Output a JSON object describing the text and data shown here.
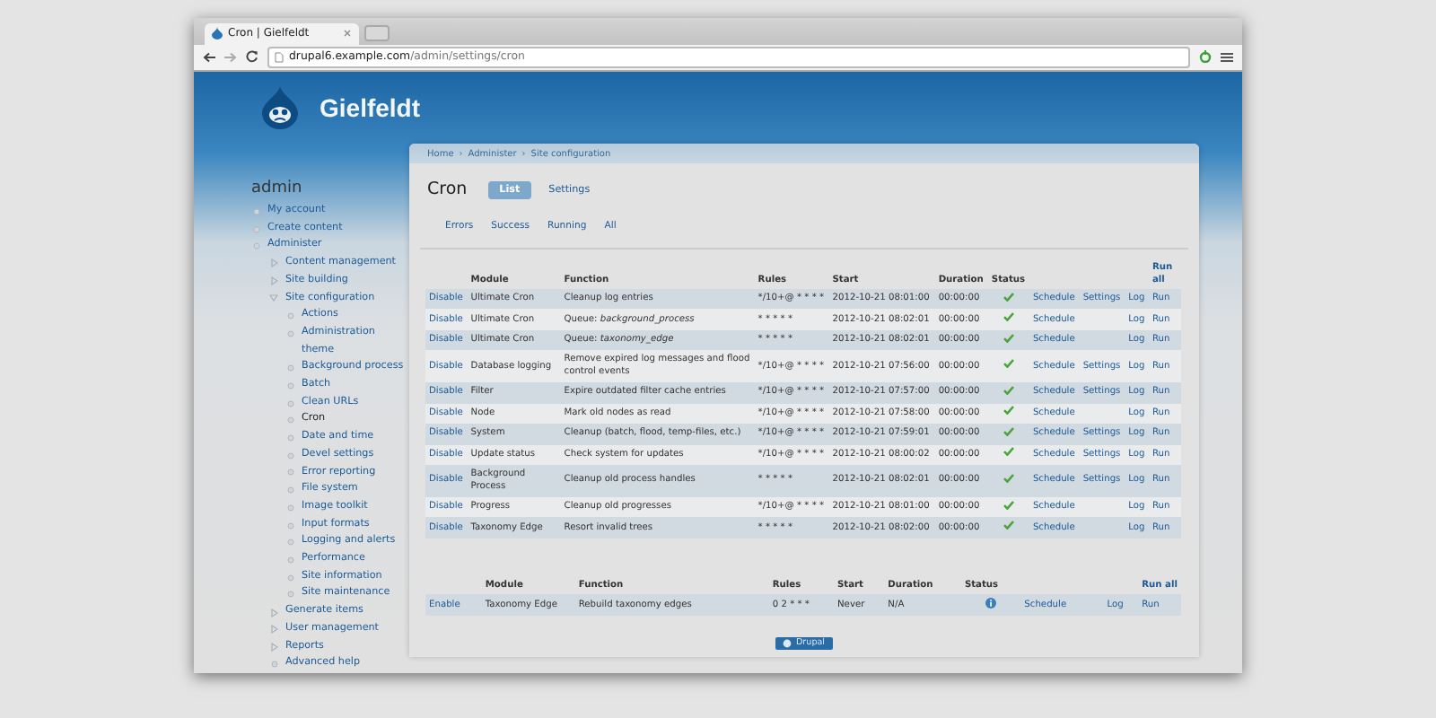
{
  "browser": {
    "tab_title": "Cron | Gielfeldt",
    "url_host": "drupal6.example.com",
    "url_path": "/admin/settings/cron"
  },
  "site": {
    "name": "Gielfeldt"
  },
  "sidebar": {
    "title": "admin",
    "items": [
      {
        "label": "My account",
        "kind": "leaf",
        "selected": false
      },
      {
        "label": "Create content",
        "kind": "leaf",
        "selected": false
      },
      {
        "label": "Administer",
        "kind": "leaf",
        "selected": false,
        "children": [
          {
            "label": "Content management",
            "kind": "collapsed",
            "selected": false
          },
          {
            "label": "Site building",
            "kind": "collapsed",
            "selected": false
          },
          {
            "label": "Site configuration",
            "kind": "expanded",
            "selected": false,
            "children": [
              {
                "label": "Actions",
                "kind": "leaf",
                "selected": false
              },
              {
                "label": "Administration theme",
                "kind": "leaf",
                "selected": false
              },
              {
                "label": "Background process",
                "kind": "leaf",
                "selected": false
              },
              {
                "label": "Batch",
                "kind": "leaf",
                "selected": false
              },
              {
                "label": "Clean URLs",
                "kind": "leaf",
                "selected": false
              },
              {
                "label": "Cron",
                "kind": "leaf",
                "selected": true
              },
              {
                "label": "Date and time",
                "kind": "leaf",
                "selected": false
              },
              {
                "label": "Devel settings",
                "kind": "leaf",
                "selected": false
              },
              {
                "label": "Error reporting",
                "kind": "leaf",
                "selected": false
              },
              {
                "label": "File system",
                "kind": "leaf",
                "selected": false
              },
              {
                "label": "Image toolkit",
                "kind": "leaf",
                "selected": false
              },
              {
                "label": "Input formats",
                "kind": "leaf",
                "selected": false
              },
              {
                "label": "Logging and alerts",
                "kind": "leaf",
                "selected": false
              },
              {
                "label": "Performance",
                "kind": "leaf",
                "selected": false
              },
              {
                "label": "Site information",
                "kind": "leaf",
                "selected": false
              },
              {
                "label": "Site maintenance",
                "kind": "leaf",
                "selected": false
              }
            ]
          },
          {
            "label": "Generate items",
            "kind": "collapsed",
            "selected": false
          },
          {
            "label": "User management",
            "kind": "collapsed",
            "selected": false
          },
          {
            "label": "Reports",
            "kind": "collapsed",
            "selected": false
          },
          {
            "label": "Advanced help",
            "kind": "leaf",
            "selected": false
          }
        ]
      }
    ]
  },
  "breadcrumb": {
    "separator": "›",
    "items": [
      "Home",
      "Administer",
      "Site configuration"
    ]
  },
  "page_title": "Cron",
  "tabs": [
    {
      "label": "List",
      "selected": true
    },
    {
      "label": "Settings",
      "selected": false
    }
  ],
  "subtabs": [
    {
      "label": "Errors",
      "selected": false
    },
    {
      "label": "Success",
      "selected": false
    },
    {
      "label": "Running",
      "selected": false
    },
    {
      "label": "All",
      "selected": false
    }
  ],
  "tables": [
    {
      "columns": [
        "Module",
        "Function",
        "Rules",
        "Start",
        "Duration",
        "Status",
        "Run all"
      ],
      "rows": [
        {
          "action": "Disable",
          "module": "Ultimate Cron",
          "function": "Cleanup log entries",
          "rules": "*/10+@ * * * *",
          "start": "2012-10-21 08:01:00",
          "duration": "00:00:00",
          "status": {
            "kind": "ok"
          },
          "schedule": "Schedule",
          "settings": "Settings",
          "log": "Log",
          "run": "Run"
        },
        {
          "action": "Disable",
          "module": "Ultimate Cron",
          "function": "Queue: *background_process*",
          "rules": "* * * * *",
          "start": "2012-10-21 08:02:01",
          "duration": "00:00:00",
          "status": {
            "kind": "ok"
          },
          "schedule": "Schedule",
          "log": "Log",
          "run": "Run"
        },
        {
          "action": "Disable",
          "module": "Ultimate Cron",
          "function": "Queue: *taxonomy_edge*",
          "rules": "* * * * *",
          "start": "2012-10-21 08:02:01",
          "duration": "00:00:00",
          "status": {
            "kind": "ok"
          },
          "schedule": "Schedule",
          "log": "Log",
          "run": "Run"
        },
        {
          "action": "Disable",
          "module": "Database logging",
          "function": "Remove expired log messages and flood control events",
          "rules": "*/10+@ * * * *",
          "start": "2012-10-21 07:56:00",
          "duration": "00:00:00",
          "status": {
            "kind": "ok"
          },
          "schedule": "Schedule",
          "settings": "Settings",
          "log": "Log",
          "run": "Run"
        },
        {
          "action": "Disable",
          "module": "Filter",
          "function": "Expire outdated filter cache entries",
          "rules": "*/10+@ * * * *",
          "start": "2012-10-21 07:57:00",
          "duration": "00:00:00",
          "status": {
            "kind": "ok"
          },
          "schedule": "Schedule",
          "settings": "Settings",
          "log": "Log",
          "run": "Run"
        },
        {
          "action": "Disable",
          "module": "Node",
          "function": "Mark old nodes as read",
          "rules": "*/10+@ * * * *",
          "start": "2012-10-21 07:58:00",
          "duration": "00:00:00",
          "status": {
            "kind": "ok"
          },
          "schedule": "Schedule",
          "log": "Log",
          "run": "Run"
        },
        {
          "action": "Disable",
          "module": "System",
          "function": "Cleanup (batch, flood, temp-files, etc.)",
          "rules": "*/10+@ * * * *",
          "start": "2012-10-21 07:59:01",
          "duration": "00:00:00",
          "status": {
            "kind": "ok"
          },
          "schedule": "Schedule",
          "settings": "Settings",
          "log": "Log",
          "run": "Run"
        },
        {
          "action": "Disable",
          "module": "Update status",
          "function": "Check system for updates",
          "rules": "*/10+@ * * * *",
          "start": "2012-10-21 08:00:02",
          "duration": "00:00:00",
          "status": {
            "kind": "ok"
          },
          "schedule": "Schedule",
          "settings": "Settings",
          "log": "Log",
          "run": "Run"
        },
        {
          "action": "Disable",
          "module": "Background Process",
          "function": "Cleanup old process handles",
          "rules": "* * * * *",
          "start": "2012-10-21 08:02:01",
          "duration": "00:00:00",
          "status": {
            "kind": "ok"
          },
          "schedule": "Schedule",
          "settings": "Settings",
          "log": "Log",
          "run": "Run"
        },
        {
          "action": "Disable",
          "module": "Progress",
          "function": "Cleanup old progresses",
          "rules": "*/10+@ * * * *",
          "start": "2012-10-21 08:01:00",
          "duration": "00:00:00",
          "status": {
            "kind": "ok"
          },
          "schedule": "Schedule",
          "log": "Log",
          "run": "Run"
        },
        {
          "action": "Disable",
          "module": "Taxonomy Edge",
          "function": "Resort invalid trees",
          "rules": "* * * * *",
          "start": "2012-10-21 08:02:00",
          "duration": "00:00:00",
          "status": {
            "kind": "ok"
          },
          "schedule": "Schedule",
          "log": "Log",
          "run": "Run"
        }
      ]
    },
    {
      "columns": [
        "Module",
        "Function",
        "Rules",
        "Start",
        "Duration",
        "Status",
        "Run all"
      ],
      "rows": [
        {
          "action": "Enable",
          "module": "Taxonomy Edge",
          "function": "Rebuild taxonomy edges",
          "rules": "0 2 * * *",
          "start": "Never",
          "duration": "N/A",
          "status": {
            "kind": "info"
          },
          "schedule": "Schedule",
          "log": "Log",
          "run": "Run"
        }
      ]
    }
  ],
  "footer": {
    "badge": "Drupal"
  }
}
